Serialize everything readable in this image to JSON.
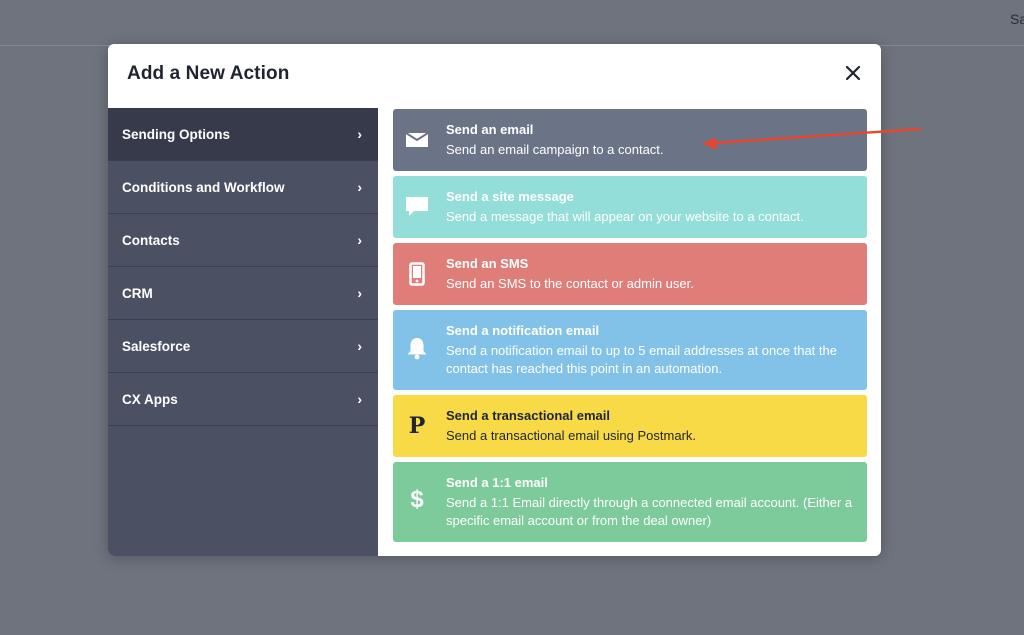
{
  "topbar": {
    "partial_text": "Sa"
  },
  "modal": {
    "title": "Add a New Action",
    "close_label": "×"
  },
  "sidebar": {
    "items": [
      {
        "label": "Sending Options",
        "chevron": "›",
        "active": true
      },
      {
        "label": "Conditions and Workflow",
        "chevron": "›"
      },
      {
        "label": "Contacts",
        "chevron": "›"
      },
      {
        "label": "CRM",
        "chevron": "›"
      },
      {
        "label": "Salesforce",
        "chevron": "›"
      },
      {
        "label": "CX Apps",
        "chevron": "›"
      }
    ]
  },
  "actions": [
    {
      "title": "Send an email",
      "desc": "Send an email campaign to a contact.",
      "icon": "envelope-icon",
      "bg": "#6b7387",
      "fg": "#ffffff"
    },
    {
      "title": "Send a site message",
      "desc": "Send a message that will appear on your website to a contact.",
      "icon": "chat-bubble-icon",
      "bg": "#93ded9",
      "fg": "#ffffff"
    },
    {
      "title": "Send an SMS",
      "desc": "Send an SMS to the contact or admin user.",
      "icon": "phone-icon",
      "bg": "#df7d79",
      "fg": "#ffffff"
    },
    {
      "title": "Send a notification email",
      "desc": "Send a notification email to up to 5 email addresses at once that the contact has reached this point in an automation.",
      "icon": "bell-icon",
      "bg": "#82c2e8",
      "fg": "#ffffff"
    },
    {
      "title": "Send a transactional email",
      "desc": "Send a transactional email using Postmark.",
      "icon": "postmark-p-icon",
      "icon_glyph": "P",
      "bg": "#f8da47",
      "fg": "#1f2430"
    },
    {
      "title": "Send a 1:1 email",
      "desc": "Send a 1:1 Email directly through a connected email account. (Either a specific email account or from the deal owner)",
      "icon": "dollar-icon",
      "icon_glyph": "$",
      "bg": "#7dca9a",
      "fg": "#ffffff"
    }
  ],
  "colors": {
    "overlay": "#6f737d",
    "sidebar": "#4c5063",
    "sidebar_active": "#373a4a",
    "annotation_arrow": "#e8472f"
  }
}
